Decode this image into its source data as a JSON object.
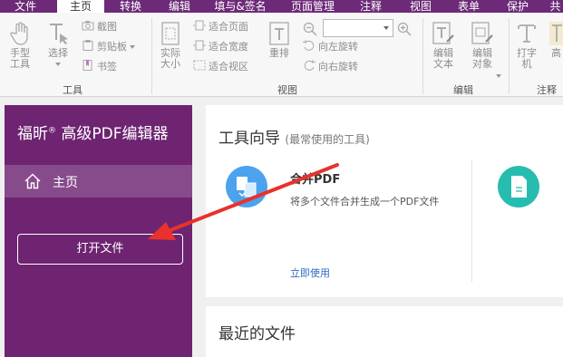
{
  "menu": {
    "tabs": [
      {
        "label": "文件"
      },
      {
        "label": "主页"
      },
      {
        "label": "转换"
      },
      {
        "label": "编辑"
      },
      {
        "label": "填与&签名"
      },
      {
        "label": "页面管理"
      },
      {
        "label": "注释"
      },
      {
        "label": "视图"
      },
      {
        "label": "表单"
      },
      {
        "label": "保护"
      },
      {
        "label": "共"
      }
    ]
  },
  "ribbon": {
    "tools_group": {
      "hand_tool": "手型工具",
      "select": "选择",
      "screenshot": "截图",
      "clipboard": "剪贴板",
      "bookmark": "书签",
      "label": "工具"
    },
    "view_group": {
      "actual_size": "实际大小",
      "fit_page": "适合页面",
      "fit_width": "适合宽度",
      "fit_visible": "适合视区",
      "reflow": "重排",
      "rotate_left": "向左旋转",
      "rotate_right": "向右旋转",
      "label": "视图"
    },
    "edit_group": {
      "edit_text": "编辑文本",
      "edit_object": "编辑对象",
      "label": "编辑"
    },
    "comment_group": {
      "typewriter": "打字机",
      "highlight": "高",
      "label": "注释"
    }
  },
  "sidebar": {
    "brand": "福昕",
    "brand_mark": "®",
    "brand_product": " 高级PDF编辑器",
    "home_label": "主页",
    "open_file_label": "打开文件"
  },
  "main": {
    "guide": {
      "title": "工具向导",
      "subtitle": "(最常使用的工具)",
      "tool_name": "合并PDF",
      "tool_desc": "将多个文件合并生成一个PDF文件",
      "tool_link": "立即使用"
    },
    "recent": {
      "title": "最近的文件"
    }
  },
  "colors": {
    "brand_purple": "#6e2471",
    "home_highlight": "#874b8c",
    "arrow_red": "#e8322b",
    "merge_icon_blue": "#4ba3ee",
    "second_icon_teal": "#26bdb0",
    "link_blue": "#2f6bbf"
  }
}
